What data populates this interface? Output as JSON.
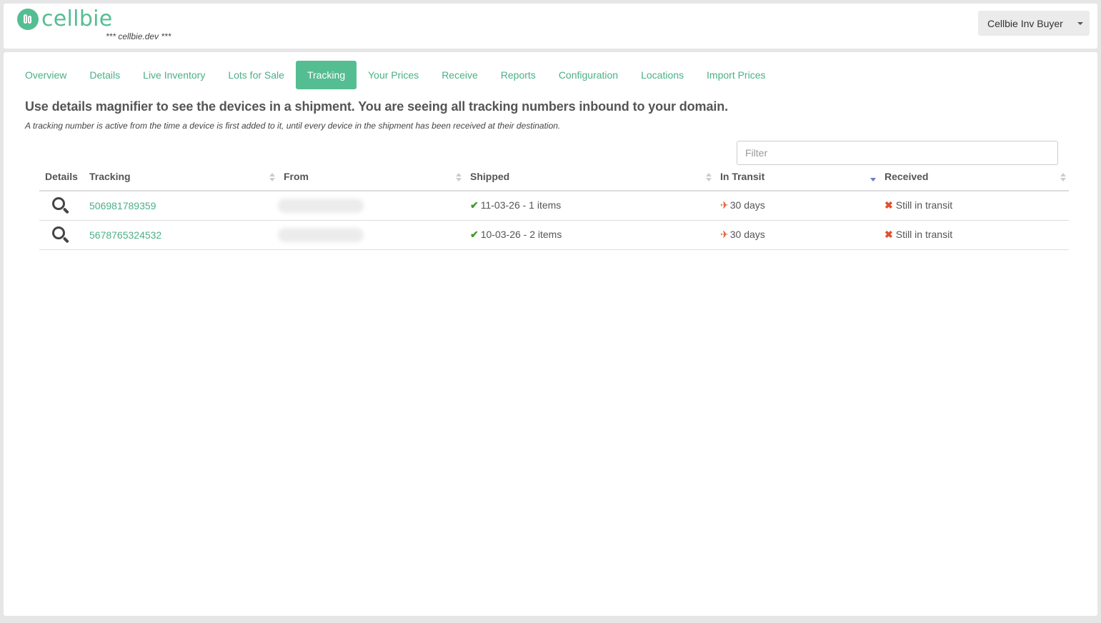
{
  "header": {
    "brand": "cellbie",
    "env_label": "*** cellbie.dev ***",
    "user_menu": "Cellbie Inv Buyer"
  },
  "tabs": [
    {
      "label": "Overview"
    },
    {
      "label": "Details"
    },
    {
      "label": "Live Inventory"
    },
    {
      "label": "Lots for Sale"
    },
    {
      "label": "Tracking",
      "active": true
    },
    {
      "label": "Your Prices"
    },
    {
      "label": "Receive"
    },
    {
      "label": "Reports"
    },
    {
      "label": "Configuration"
    },
    {
      "label": "Locations"
    },
    {
      "label": "Import Prices"
    }
  ],
  "content": {
    "lead": "Use details magnifier to see the devices in a shipment. You are seeing all tracking numbers inbound to your domain.",
    "note": "A tracking number is active from the time a device is first added to it, until every device in the shipment has been received at their destination.",
    "filter_placeholder": "Filter"
  },
  "table": {
    "columns": {
      "details": "Details",
      "tracking": "Tracking",
      "from": "From",
      "shipped": "Shipped",
      "in_transit": "In Transit",
      "received": "Received"
    },
    "sorted_column": "in_transit",
    "sort_direction": "desc",
    "rows": [
      {
        "tracking": "506981789359",
        "shipped": "11-03-26 - 1 items",
        "in_transit": "30 days",
        "received": "Still in transit"
      },
      {
        "tracking": "5678765324532",
        "shipped": "10-03-26 - 2 items",
        "in_transit": "30 days",
        "received": "Still in transit"
      }
    ]
  },
  "colors": {
    "brand": "#55bd92",
    "link": "#4ab087",
    "check": "#3e9a2c",
    "alert": "#e05a28"
  },
  "icons": {
    "details": "magnifier-icon",
    "shipped": "checkmark-icon",
    "in_transit": "airplane-icon",
    "received": "x-mark-icon"
  }
}
